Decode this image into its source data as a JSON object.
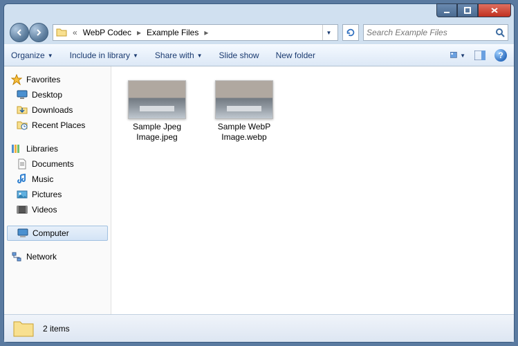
{
  "nav": {
    "breadcrumb_prefix": "«",
    "crumb1": "WebP Codec",
    "crumb2": "Example Files"
  },
  "search": {
    "placeholder": "Search Example Files"
  },
  "toolbar": {
    "organize": "Organize",
    "include": "Include in library",
    "share": "Share with",
    "slideshow": "Slide show",
    "newfolder": "New folder"
  },
  "sidebar": {
    "favorites": "Favorites",
    "desktop": "Desktop",
    "downloads": "Downloads",
    "recent": "Recent Places",
    "libraries": "Libraries",
    "documents": "Documents",
    "music": "Music",
    "pictures": "Pictures",
    "videos": "Videos",
    "computer": "Computer",
    "network": "Network"
  },
  "files": {
    "f1_line1": "Sample Jpeg",
    "f1_line2": "Image.jpeg",
    "f2_line1": "Sample WebP",
    "f2_line2": "Image.webp"
  },
  "status": {
    "count": "2 items"
  }
}
